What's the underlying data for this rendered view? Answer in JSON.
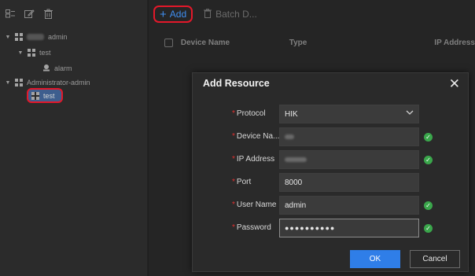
{
  "main_toolbar": {
    "add_label": "Add",
    "batch_delete_label": "Batch D..."
  },
  "tree": {
    "root_label": "admin",
    "child_label": "test",
    "grandchild_label": "alarm",
    "group_label": "Administrator-admin",
    "selected_label": "test"
  },
  "table": {
    "columns": [
      "Device Name",
      "Type",
      "IP Address"
    ]
  },
  "dialog": {
    "title": "Add Resource",
    "fields": {
      "protocol": {
        "label": "Protocol",
        "value": "HIK"
      },
      "device_name": {
        "label": "Device Na..."
      },
      "ip_address": {
        "label": "IP Address"
      },
      "port": {
        "label": "Port",
        "value": "8000"
      },
      "user_name": {
        "label": "User Name",
        "value": "admin"
      },
      "password": {
        "label": "Password",
        "value": "●●●●●●●●●●"
      }
    },
    "ok_label": "OK",
    "cancel_label": "Cancel"
  }
}
